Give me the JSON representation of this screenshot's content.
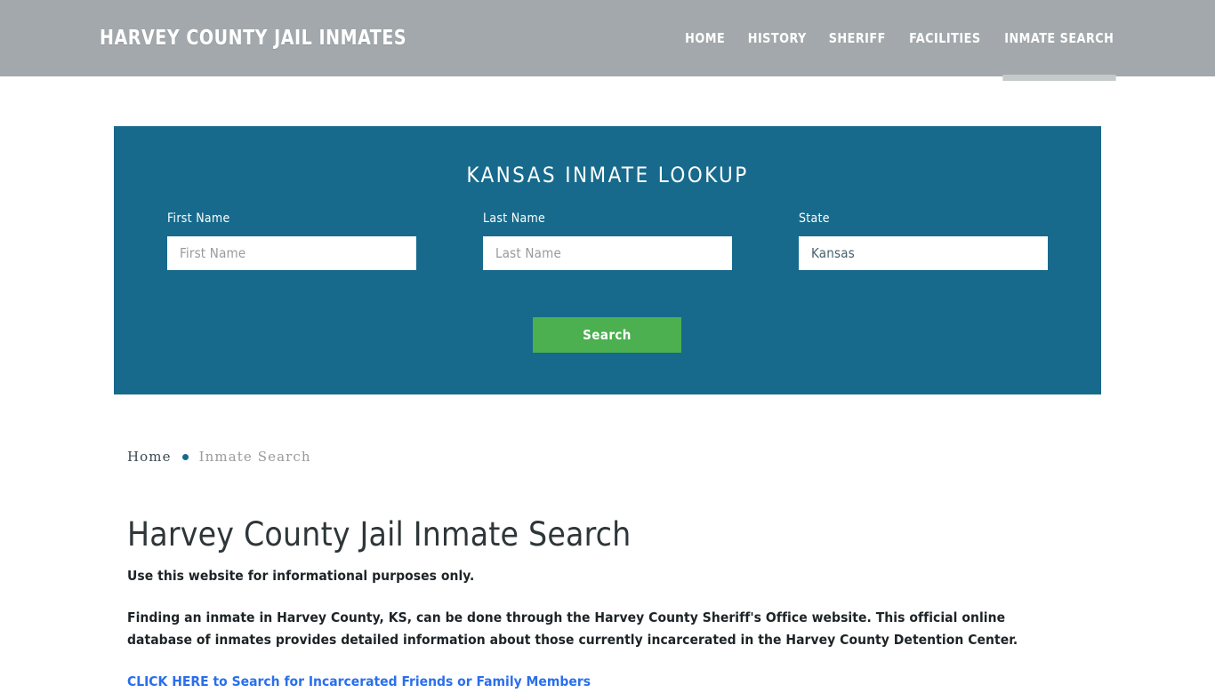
{
  "header": {
    "brand": "HARVEY COUNTY JAIL INMATES",
    "background_color": "#a2a8ab",
    "nav": [
      {
        "label": "HOME",
        "active": false
      },
      {
        "label": "HISTORY",
        "active": false
      },
      {
        "label": "SHERIFF",
        "active": false
      },
      {
        "label": "FACILITIES",
        "active": false
      },
      {
        "label": "INMATE SEARCH",
        "active": true
      }
    ]
  },
  "lookup": {
    "title": "KANSAS INMATE LOOKUP",
    "panel_color": "#176a8c",
    "fields": {
      "first_name": {
        "label": "First Name",
        "value": "",
        "placeholder": "First Name"
      },
      "last_name": {
        "label": "Last Name",
        "value": "",
        "placeholder": "Last Name"
      },
      "state": {
        "label": "State",
        "value": "Kansas",
        "placeholder": "State"
      }
    },
    "search_button": {
      "label": "Search",
      "color": "#4CAF50"
    }
  },
  "breadcrumb": {
    "home": "Home",
    "separator": "•",
    "current": "Inmate Search"
  },
  "main": {
    "title": "Harvey County Jail Inmate Search",
    "paragraph_1": "Use this website for informational purposes only.",
    "paragraph_2": "Finding an inmate in Harvey County, KS, can be done through the Harvey County Sheriff's Office website. This official online database of inmates provides detailed information about those currently incarcerated in the Harvey County Detention Center.",
    "link": {
      "label": "CLICK HERE to Search for Incarcerated Friends or Family Members",
      "color": "#2a6fec"
    }
  }
}
